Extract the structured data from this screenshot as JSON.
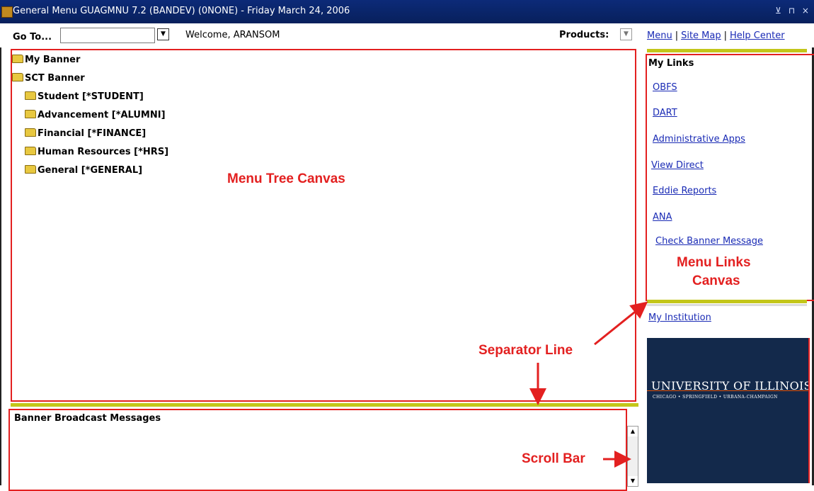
{
  "window": {
    "title": "General Menu  GUAGMNU  7.2  (BANDEV)  (0NONE) - Friday March 24, 2006",
    "controls": "⊻ ⊓ ×"
  },
  "toolbar": {
    "goto_label": "Go To...",
    "goto_value": "",
    "welcome": "Welcome, ARANSOM",
    "products_label": "Products:",
    "links": [
      "Menu",
      "Site Map",
      "Help Center"
    ]
  },
  "tree": {
    "items": [
      {
        "label": "My Banner"
      },
      {
        "label": "SCT Banner"
      },
      {
        "label": "Student [*STUDENT]"
      },
      {
        "label": "Advancement [*ALUMNI]"
      },
      {
        "label": "Financial [*FINANCE]"
      },
      {
        "label": "Human Resources [*HRS]"
      },
      {
        "label": "General [*GENERAL]"
      }
    ],
    "annotation": "Menu Tree Canvas"
  },
  "broadcast": {
    "header": "Banner Broadcast Messages"
  },
  "links_pane": {
    "header": "My Links",
    "links": [
      "OBFS",
      "DART",
      "Administrative Apps",
      "View Direct",
      "Eddie Reports",
      "ANA",
      "Check Banner Message"
    ],
    "annotation_line1": "Menu Links",
    "annotation_line2": "Canvas",
    "my_institution": "My Institution"
  },
  "logo": {
    "name": "UNIVERSITY OF ILLINOIS",
    "campuses": "CHICAGO • SPRINGFIELD • URBANA-CHAMPAIGN"
  },
  "annotations": {
    "separator_line": "Separator Line",
    "scroll_bar": "Scroll Bar"
  },
  "colors": {
    "titlebar": "#0c2a78",
    "separator": "#c3c61a",
    "annotation_red": "#e32020",
    "link_blue": "#1a2bb5",
    "uiuc_navy": "#13294b"
  }
}
